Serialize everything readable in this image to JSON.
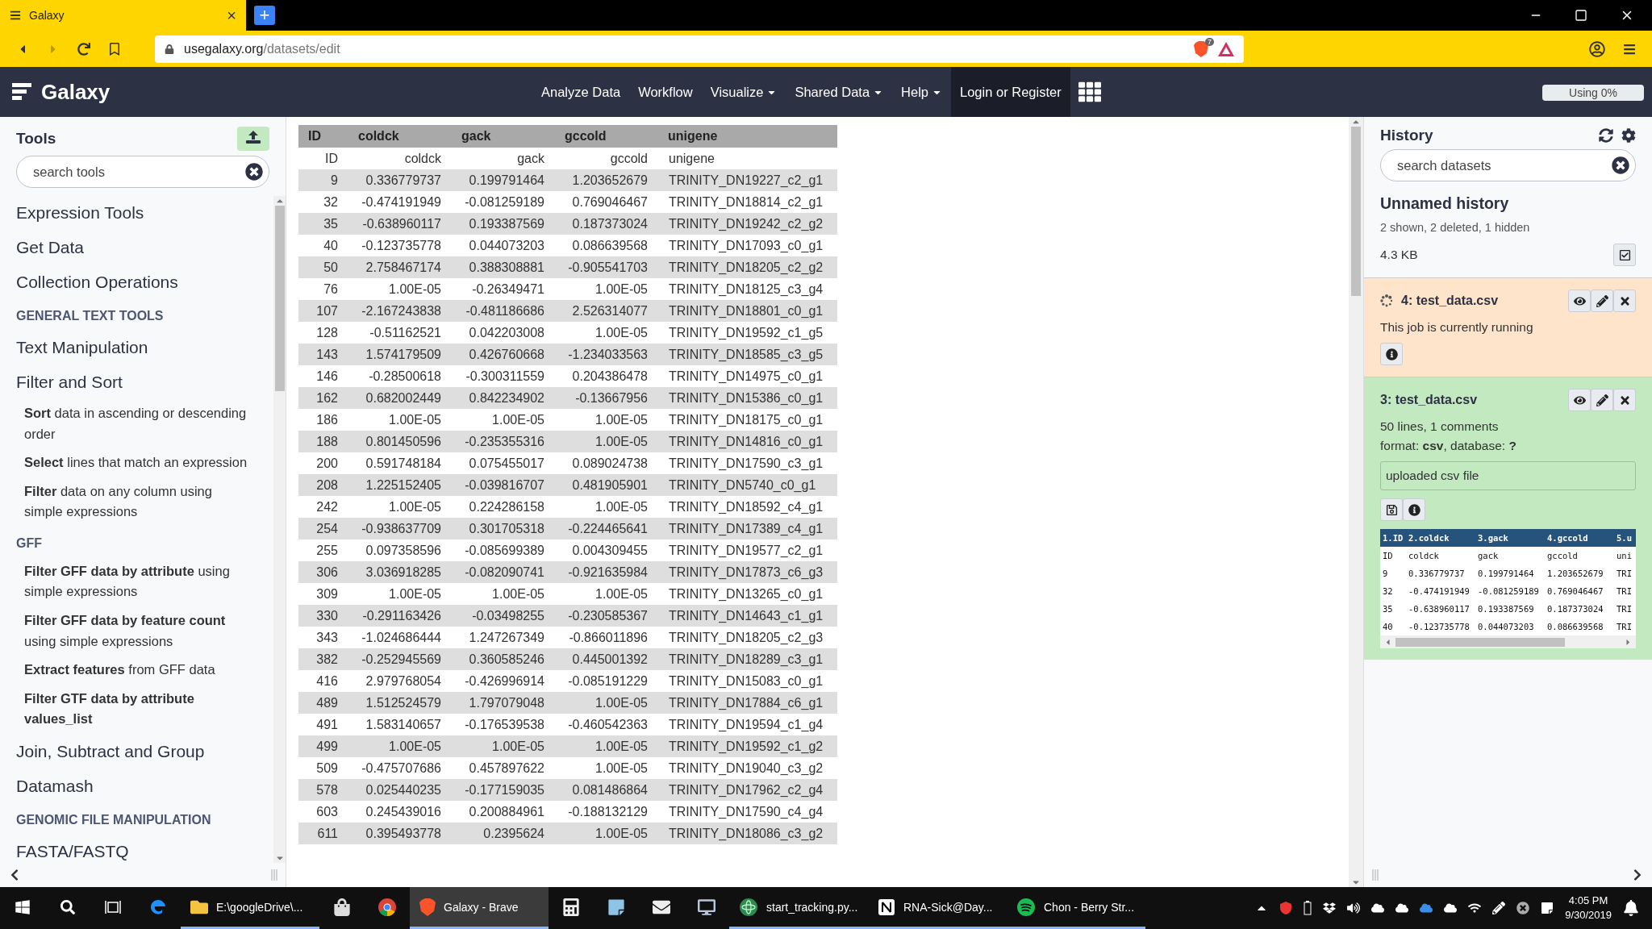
{
  "browser": {
    "tab_title": "Galaxy",
    "tab_close": "×",
    "new_tab": "+",
    "url_domain": "usegalaxy.org",
    "url_path": "/datasets/edit",
    "shield_count": "7"
  },
  "masthead": {
    "brand": "Galaxy",
    "nav": [
      {
        "label": "Analyze Data",
        "dropdown": false,
        "selected": false
      },
      {
        "label": "Workflow",
        "dropdown": false,
        "selected": false
      },
      {
        "label": "Visualize",
        "dropdown": true,
        "selected": false
      },
      {
        "label": "Shared Data",
        "dropdown": true,
        "selected": false
      },
      {
        "label": "Help",
        "dropdown": true,
        "selected": false
      },
      {
        "label": "Login or Register",
        "dropdown": false,
        "selected": true
      }
    ],
    "quota": {
      "label": "Using 0%",
      "level": 0
    }
  },
  "tools": {
    "title": "Tools",
    "search": {
      "placeholder": "search tools"
    },
    "items": [
      {
        "kind": "section",
        "text": "Expression Tools"
      },
      {
        "kind": "section",
        "text": "Get Data"
      },
      {
        "kind": "section",
        "text": "Collection Operations"
      },
      {
        "kind": "label",
        "text": "**GENERAL TEXT TOOLS**"
      },
      {
        "kind": "section",
        "text": "Text Manipulation"
      },
      {
        "kind": "section",
        "text": "Filter and Sort"
      },
      {
        "kind": "tool",
        "text": "**Sort** data in ascending or descending order"
      },
      {
        "kind": "tool",
        "text": "**Select** lines that match an expression"
      },
      {
        "kind": "tool",
        "text": "**Filter** data on any column using simple expressions"
      },
      {
        "kind": "label",
        "text": "**GFF**"
      },
      {
        "kind": "tool",
        "text": "**Filter GFF data by attribute** using simple expressions"
      },
      {
        "kind": "tool",
        "text": "**Filter GFF data by feature count** using simple expressions"
      },
      {
        "kind": "tool",
        "text": "**Extract features** from GFF data"
      },
      {
        "kind": "tool",
        "text": "**Filter GTF data by attribute values_list**"
      },
      {
        "kind": "section",
        "text": "Join, Subtract and Group"
      },
      {
        "kind": "section",
        "text": "Datamash"
      },
      {
        "kind": "label",
        "text": "**GENOMIC FILE MANIPULATION**"
      },
      {
        "kind": "section",
        "text": "FASTA/FASTQ"
      }
    ]
  },
  "table": {
    "columns": [
      "ID",
      "coldck",
      "gack",
      "gccold",
      "unigene"
    ],
    "rows": [
      [
        "ID",
        "coldck",
        "gack",
        "gccold",
        "unigene"
      ],
      [
        "9",
        "0.336779737",
        "0.199791464",
        "1.203652679",
        "TRINITY_DN19227_c2_g1"
      ],
      [
        "32",
        "-0.474191949",
        "-0.081259189",
        "0.769046467",
        "TRINITY_DN18814_c2_g1"
      ],
      [
        "35",
        "-0.638960117",
        "0.193387569",
        "0.187373024",
        "TRINITY_DN19242_c2_g2"
      ],
      [
        "40",
        "-0.123735778",
        "0.044073203",
        "0.086639568",
        "TRINITY_DN17093_c0_g1"
      ],
      [
        "50",
        "2.758467174",
        "0.388308881",
        "-0.905541703",
        "TRINITY_DN18205_c2_g2"
      ],
      [
        "76",
        "1.00E-05",
        "-0.26349471",
        "1.00E-05",
        "TRINITY_DN18125_c3_g4"
      ],
      [
        "107",
        "-2.167243838",
        "-0.481186686",
        "2.526314077",
        "TRINITY_DN18801_c0_g1"
      ],
      [
        "128",
        "-0.51162521",
        "0.042203008",
        "1.00E-05",
        "TRINITY_DN19592_c1_g5"
      ],
      [
        "143",
        "1.574179509",
        "0.426760668",
        "-1.234033563",
        "TRINITY_DN18585_c3_g5"
      ],
      [
        "146",
        "-0.28500618",
        "-0.300311559",
        "0.204386478",
        "TRINITY_DN14975_c0_g1"
      ],
      [
        "162",
        "0.682002449",
        "0.842234902",
        "-0.13667956",
        "TRINITY_DN15386_c0_g1"
      ],
      [
        "186",
        "1.00E-05",
        "1.00E-05",
        "1.00E-05",
        "TRINITY_DN18175_c0_g1"
      ],
      [
        "188",
        "0.801450596",
        "-0.235355316",
        "1.00E-05",
        "TRINITY_DN14816_c0_g1"
      ],
      [
        "200",
        "0.591748184",
        "0.075455017",
        "0.089024738",
        "TRINITY_DN17590_c3_g1"
      ],
      [
        "208",
        "1.225152405",
        "-0.039816707",
        "0.481905901",
        "TRINITY_DN5740_c0_g1"
      ],
      [
        "242",
        "1.00E-05",
        "0.224286158",
        "1.00E-05",
        "TRINITY_DN18592_c4_g1"
      ],
      [
        "254",
        "-0.938637709",
        "0.301705318",
        "-0.224465641",
        "TRINITY_DN17389_c4_g1"
      ],
      [
        "255",
        "0.097358596",
        "-0.085699389",
        "0.004309455",
        "TRINITY_DN19577_c2_g1"
      ],
      [
        "306",
        "3.036918285",
        "-0.082090741",
        "-0.921635984",
        "TRINITY_DN17873_c6_g3"
      ],
      [
        "309",
        "1.00E-05",
        "1.00E-05",
        "1.00E-05",
        "TRINITY_DN13265_c0_g1"
      ],
      [
        "330",
        "-0.291163426",
        "-0.03498255",
        "-0.230585367",
        "TRINITY_DN14643_c1_g1"
      ],
      [
        "343",
        "-1.024686444",
        "1.247267349",
        "-0.866011896",
        "TRINITY_DN18205_c2_g3"
      ],
      [
        "382",
        "-0.252945569",
        "0.360585246",
        "0.445001392",
        "TRINITY_DN18289_c3_g1"
      ],
      [
        "416",
        "2.979768054",
        "-0.426996914",
        "-0.085191229",
        "TRINITY_DN15083_c0_g1"
      ],
      [
        "489",
        "1.512524579",
        "1.797079048",
        "1.00E-05",
        "TRINITY_DN17884_c6_g1"
      ],
      [
        "491",
        "1.583140657",
        "-0.176539538",
        "-0.460542363",
        "TRINITY_DN19594_c1_g4"
      ],
      [
        "499",
        "1.00E-05",
        "1.00E-05",
        "1.00E-05",
        "TRINITY_DN19592_c1_g2"
      ],
      [
        "509",
        "-0.475707686",
        "0.457897622",
        "1.00E-05",
        "TRINITY_DN19040_c3_g2"
      ],
      [
        "578",
        "0.025440235",
        "-0.177159035",
        "0.081486864",
        "TRINITY_DN17962_c2_g4"
      ],
      [
        "603",
        "0.245439016",
        "0.200884961",
        "-0.188132129",
        "TRINITY_DN17590_c4_g4"
      ],
      [
        "611",
        "0.395493778",
        "0.2395624",
        "1.00E-05",
        "TRINITY_DN18086_c3_g2"
      ]
    ]
  },
  "history": {
    "title": "History",
    "search": {
      "placeholder": "search datasets"
    },
    "name": "Unnamed history",
    "counts": "2 shown, 2 deleted, 1 hidden",
    "size": "4.3 KB",
    "datasets": [
      {
        "kind": "running",
        "title": "4: test_data.csv",
        "message": "This job is currently running"
      },
      {
        "kind": "ok",
        "title": "3: test_data.csv",
        "summary": "50 lines, 1 comments",
        "format": "format: **csv**, database: **?**",
        "info": "uploaded csv file",
        "peek": {
          "columns": [
            "1.ID",
            "2.coldck",
            "3.gack",
            "4.gccold",
            "5.u"
          ],
          "rows": [
            [
              "ID",
              "coldck",
              "gack",
              "gccold",
              "uni"
            ],
            [
              "9",
              "0.336779737",
              "0.199791464",
              "1.203652679",
              "TRI"
            ],
            [
              "32",
              "-0.474191949",
              "-0.081259189",
              "0.769046467",
              "TRI"
            ],
            [
              "35",
              "-0.638960117",
              "0.193387569",
              "0.187373024",
              "TRI"
            ],
            [
              "40",
              "-0.123735778",
              "0.044073203",
              "0.086639568",
              "TRI"
            ]
          ]
        }
      }
    ]
  },
  "taskbar": {
    "apps": [
      {
        "kind": "edge",
        "selected": false
      },
      {
        "kind": "folder",
        "label": "E:\\googleDrive\\...",
        "selected": false
      },
      {
        "kind": "store",
        "selected": false
      },
      {
        "kind": "chrome",
        "selected": false
      },
      {
        "kind": "brave",
        "label": "Galaxy - Brave",
        "selected": true
      },
      {
        "kind": "calculator",
        "selected": false
      },
      {
        "kind": "notebook",
        "selected": false
      },
      {
        "kind": "mail",
        "selected": false
      },
      {
        "kind": "computer",
        "selected": false
      },
      {
        "kind": "atom",
        "label": "start_tracking.py...",
        "selected": false
      },
      {
        "kind": "notion",
        "label": "RNA-Sick@Day...",
        "selected": false
      },
      {
        "kind": "spotify",
        "label": "Chon - Berry Str...",
        "selected": false
      }
    ],
    "time": "4:05 PM",
    "date": "9/30/2019"
  }
}
